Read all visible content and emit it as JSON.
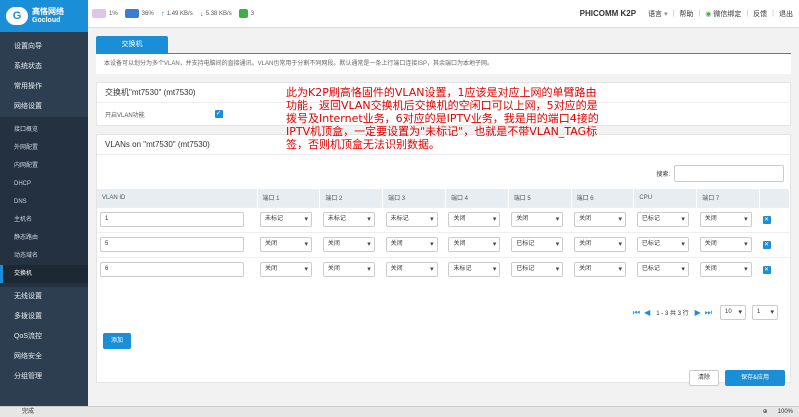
{
  "logo": {
    "cn": "高恪网络",
    "en": "Gocloud"
  },
  "sidebar": {
    "items": [
      {
        "label": "设置向导"
      },
      {
        "label": "系统状态"
      },
      {
        "label": "常用操作"
      },
      {
        "label": "网络设置"
      }
    ],
    "sub_items": [
      {
        "label": "接口概览"
      },
      {
        "label": "外网配置"
      },
      {
        "label": "内网配置"
      },
      {
        "label": "DHCP"
      },
      {
        "label": "DNS"
      },
      {
        "label": "主机名"
      },
      {
        "label": "静态路由"
      },
      {
        "label": "动态域名"
      },
      {
        "label": "交换机",
        "active": true
      }
    ],
    "bottom_items": [
      {
        "label": "无线设置"
      },
      {
        "label": "多拨设置"
      },
      {
        "label": "QoS流控"
      },
      {
        "label": "网络安全"
      },
      {
        "label": "分组管理"
      }
    ]
  },
  "topbar": {
    "cpu": "1%",
    "mem": "36%",
    "up": "1.49 KB/s",
    "down": "5.38 KB/s",
    "lan": "3",
    "model": "PHICOMM K2P",
    "links": [
      "语言",
      "帮助",
      "微信绑定",
      "反馈",
      "退出"
    ]
  },
  "tab": "交换机",
  "description": "本设备可以划分为多个VLAN，并支持电脑间的直接通讯。VLAN也常用于分割不同网段。默认通常是一条上行端口连接ISP，其余端口为本地子网。",
  "switch_card": {
    "title": "交换机\"mt7530\" (mt7530)",
    "enable_label": "开启VLAN功能",
    "enabled": true
  },
  "vlan_card": {
    "title": "VLANs on \"mt7530\" (mt7530)",
    "search_label": "搜索:",
    "headers": [
      "VLAN ID",
      "端口 1",
      "端口 2",
      "端口 3",
      "端口 4",
      "端口 5",
      "端口 6",
      "CPU",
      "端口 7"
    ],
    "rows": [
      {
        "id": "1",
        "ports": [
          "未标记",
          "未标记",
          "未标记",
          "关闭",
          "关闭",
          "关闭",
          "已标记",
          "关闭"
        ]
      },
      {
        "id": "5",
        "ports": [
          "关闭",
          "关闭",
          "关闭",
          "关闭",
          "已标记",
          "关闭",
          "已标记",
          "关闭"
        ]
      },
      {
        "id": "6",
        "ports": [
          "关闭",
          "关闭",
          "关闭",
          "未标记",
          "已标记",
          "关闭",
          "已标记",
          "关闭"
        ]
      }
    ],
    "pager_text": "1 - 3 共 3 行",
    "page_size": "10",
    "page": "1",
    "add_label": "添加"
  },
  "actions": {
    "clear": "清除",
    "save": "保存&应用"
  },
  "annotation": "此为K2P刷高恪固件的VLAN设置，1应该是对应上网的单臂路由功能，返回VLAN交换机后交换机的空闲口可以上网，5对应的是拨号及Internet业务，6对应的是IPTV业务，我是用的端口4接的IPTV机顶盒，一定要设置为\"未标记\"，也就是不带VLAN_TAG标签，否则机顶盒无法识别数据。",
  "statusbar": {
    "ready": "完成",
    "zoom": "100%"
  }
}
